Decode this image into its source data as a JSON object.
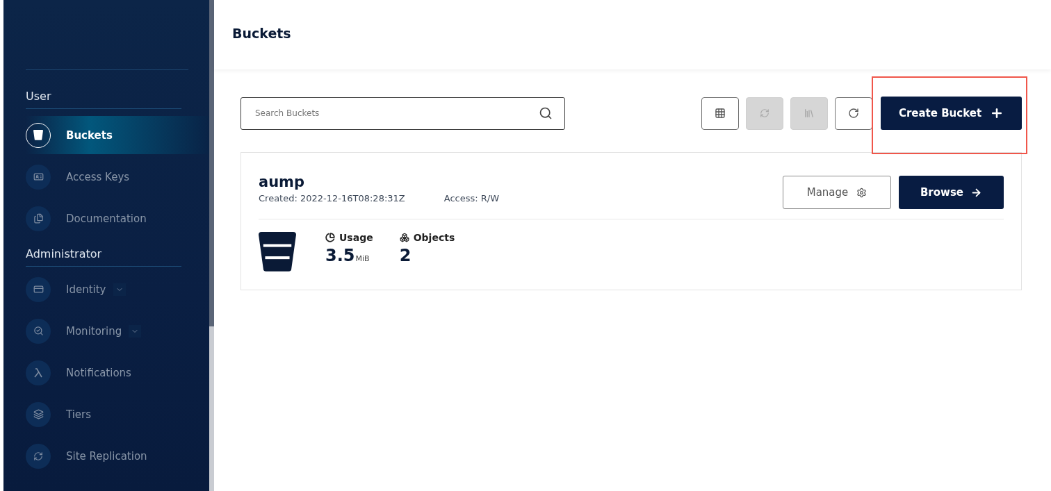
{
  "sidebar": {
    "sections": [
      {
        "title": "User",
        "items": [
          {
            "label": "Buckets",
            "selected": true,
            "expandable": false
          },
          {
            "label": "Access Keys",
            "selected": false,
            "expandable": false
          },
          {
            "label": "Documentation",
            "selected": false,
            "expandable": false
          }
        ]
      },
      {
        "title": "Administrator",
        "items": [
          {
            "label": "Identity",
            "selected": false,
            "expandable": true
          },
          {
            "label": "Monitoring",
            "selected": false,
            "expandable": true
          },
          {
            "label": "Notifications",
            "selected": false,
            "expandable": false
          },
          {
            "label": "Tiers",
            "selected": false,
            "expandable": false
          },
          {
            "label": "Site Replication",
            "selected": false,
            "expandable": false
          }
        ]
      }
    ]
  },
  "header": {
    "title": "Buckets"
  },
  "toolbar": {
    "search": {
      "placeholder": "Search Buckets"
    },
    "tools": [
      {
        "disabled": false
      },
      {
        "disabled": true
      },
      {
        "disabled": true
      },
      {
        "disabled": false
      }
    ],
    "create_button": {
      "label": "Create Bucket",
      "highlighted": true
    }
  },
  "buckets": [
    {
      "name": "aump",
      "created": "Created: 2022-12-16T08:28:31Z",
      "access": "Access: R/W",
      "manage_label": "Manage",
      "browse_label": "Browse",
      "usage_label": "Usage",
      "usage_value": "3.5",
      "usage_unit": "MiB",
      "objects_label": "Objects",
      "objects_value": "2"
    }
  ]
}
